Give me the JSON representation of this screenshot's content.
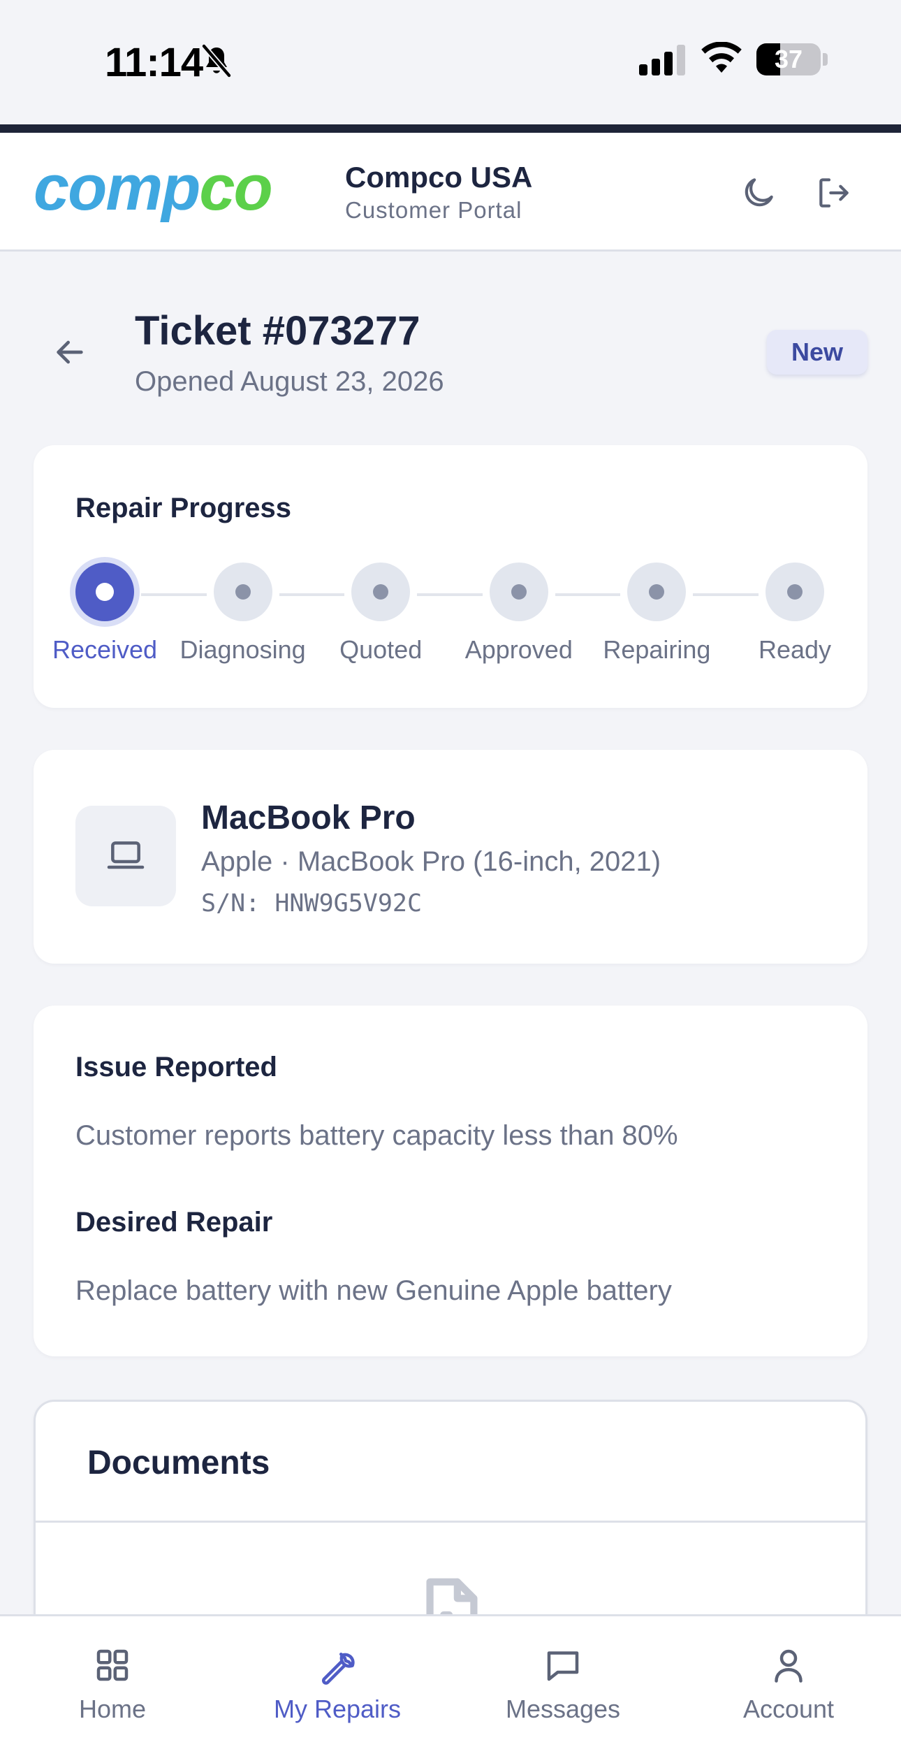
{
  "status_bar": {
    "time": "11:14",
    "battery": "37",
    "battery_fraction": 0.37
  },
  "header": {
    "logo_text": "compco",
    "brand_title": "Compco USA",
    "brand_subtitle": "Customer Portal",
    "colors": {
      "logo_blue": "#3fa7e0",
      "logo_green": "#5cd04a"
    }
  },
  "ticket": {
    "title": "Ticket #073277",
    "opened": "Opened August 23, 2026",
    "status": "New"
  },
  "progress": {
    "heading": "Repair Progress",
    "steps": [
      {
        "label": "Received",
        "active": true
      },
      {
        "label": "Diagnosing",
        "active": false
      },
      {
        "label": "Quoted",
        "active": false
      },
      {
        "label": "Approved",
        "active": false
      },
      {
        "label": "Repairing",
        "active": false
      },
      {
        "label": "Ready",
        "active": false
      }
    ]
  },
  "device": {
    "name": "MacBook Pro",
    "model": "Apple · MacBook Pro (16-inch, 2021)",
    "serial": "S/N: HNW9G5V92C",
    "icon": "laptop-icon"
  },
  "issue": {
    "issue_heading": "Issue Reported",
    "issue_text": "Customer reports battery capacity less than 80%",
    "repair_heading": "Desired Repair",
    "repair_text": "Replace battery with new Genuine Apple battery"
  },
  "documents": {
    "title": "Documents",
    "icon": "file-icon"
  },
  "nav": {
    "items": [
      {
        "label": "Home",
        "icon": "grid-icon",
        "active": false
      },
      {
        "label": "My Repairs",
        "icon": "wrench-icon",
        "active": true
      },
      {
        "label": "Messages",
        "icon": "chat-icon",
        "active": false
      },
      {
        "label": "Account",
        "icon": "user-icon",
        "active": false
      }
    ]
  },
  "theme": {
    "accent": "#4f5cc6",
    "text": "#1d2540",
    "muted": "#6b7287",
    "background": "#f3f4f8"
  }
}
